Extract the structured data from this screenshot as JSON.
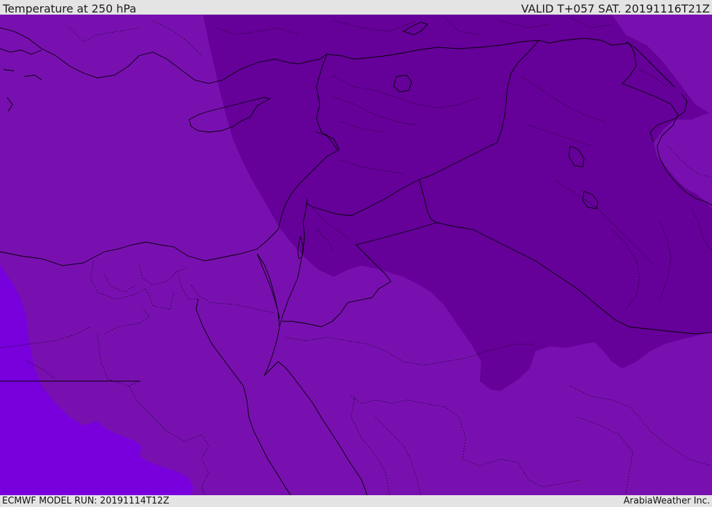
{
  "header": {
    "title": "Temperature at 250 hPa",
    "valid": "VALID T+057 SAT. 20191116T21Z"
  },
  "footer": {
    "model_run": "ECMWF MODEL RUN: 20191114T12Z",
    "credit": "ArabiaWeather Inc."
  },
  "map": {
    "field": "temperature-250hPa",
    "colors": {
      "band_cold": "#650099",
      "band_mid": "#7810b0",
      "band_warm": "#7800dc",
      "border": "#000000",
      "coast": "#000000"
    }
  }
}
